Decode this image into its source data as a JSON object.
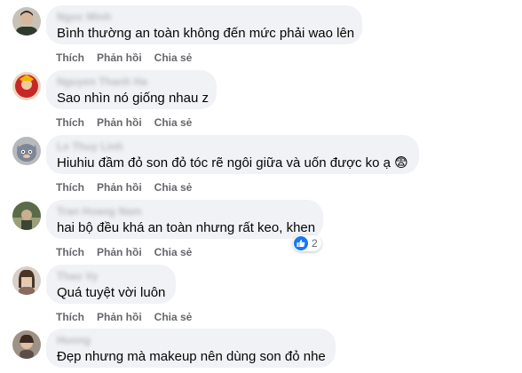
{
  "comments": [
    {
      "author": "Ngoc Minh",
      "text": "Bình thường an toàn không đến mức phải wao lên"
    },
    {
      "author": "Nguyen Thanh Ha",
      "text": "Sao nhìn nó giống nhau z"
    },
    {
      "author": "Le Thuy Linh",
      "text": "Hiuhiu đầm đỏ son đỏ tóc rẽ ngôi giữa và uốn được ko ạ 😨"
    },
    {
      "author": "Tran Hoang Nam",
      "text": "hai bộ đều khá an toàn nhưng rất keo, khen",
      "reaction_count": "2"
    },
    {
      "author": "Thao Vy",
      "text": "Quá tuyệt vời luôn"
    },
    {
      "author": "Huong",
      "text": "Đẹp nhưng mà makeup nên dùng son đỏ nhe"
    }
  ],
  "actions": {
    "like": "Thích",
    "reply": "Phản hồi",
    "share": "Chia sẻ"
  },
  "colors": {
    "bubble": "#f0f2f5",
    "action_text": "#65676b",
    "like_blue": "#1877f2"
  }
}
